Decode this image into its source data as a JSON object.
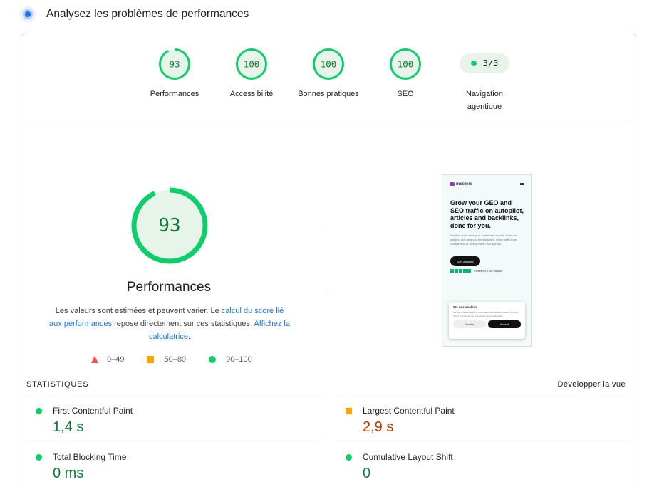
{
  "header": {
    "title": "Analysez les problèmes de performances",
    "icon": "lighthouse-icon"
  },
  "categories": [
    {
      "label": "Performances",
      "score": 93
    },
    {
      "label": "Accessibilité",
      "score": 100
    },
    {
      "label": "Bonnes pratiques",
      "score": 100
    },
    {
      "label": "SEO",
      "score": 100
    }
  ],
  "agentic": {
    "value": "3/3",
    "label_line1": "Navigation",
    "label_line2": "agentique"
  },
  "performance": {
    "score": 93,
    "title": "Performances",
    "desc_1": "Les valeurs sont estimées et peuvent varier. Le ",
    "link_1": "calcul du score lié aux performances",
    "desc_2": " repose directement sur ces statistiques. ",
    "link_2": "Affichez la calculatrice",
    "desc_3": "."
  },
  "legend": {
    "fail": "0–49",
    "average": "50–89",
    "pass": "90–100"
  },
  "screenshot": {
    "logo_text": "meeters",
    "headline": "Grow your GEO and SEO traffic on autopilot, articles and backlinks, done for you.",
    "body": "Meeters finds what your customers search, writes the articles, and gets you the backlinks. More traffic from Google and AI, every month. No agency.",
    "cta": "Get Started",
    "rating": "Excellent 4.8 on Trustpilot",
    "cookie_title": "We use cookies",
    "cookie_text": "We use simple cookies to understand how the site is used. They only help if you accept. See our privacy and cookie policy.",
    "decline": "Decline",
    "accept": "Accept"
  },
  "statistics": {
    "label": "STATISTIQUES",
    "expand": "Développer la vue",
    "metrics": [
      {
        "name": "First Contentful Paint",
        "value": "1,4 s",
        "rating": "pass"
      },
      {
        "name": "Largest Contentful Paint",
        "value": "2,9 s",
        "rating": "average"
      },
      {
        "name": "Total Blocking Time",
        "value": "0 ms",
        "rating": "pass"
      },
      {
        "name": "Cumulative Layout Shift",
        "value": "0",
        "rating": "pass"
      }
    ]
  },
  "colors": {
    "pass": "#0cce6b",
    "pass_text": "#0d7d38",
    "average": "#ffa400",
    "average_text": "#c33300",
    "fail": "#ff4e42",
    "link": "#1a73e8"
  }
}
